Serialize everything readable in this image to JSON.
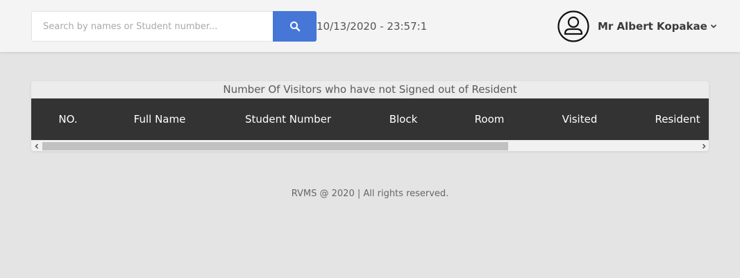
{
  "header": {
    "search": {
      "placeholder": "Search by names or Student number...",
      "value": "",
      "button_icon": "search-icon"
    },
    "datetime": "10/13/2020 - 23:57:1",
    "user": {
      "name": "Mr Albert Kopakae",
      "avatar_icon": "user-circle-icon",
      "dropdown_icon": "chevron-down-icon"
    }
  },
  "visitors_table": {
    "title": "Number Of Visitors who have not Signed out of Resident",
    "columns": [
      "NO.",
      "Full Name",
      "Student Number",
      "Block",
      "Room",
      "Visited",
      "Resident"
    ],
    "rows": []
  },
  "footer": {
    "text": "RVMS @ 2020 | All rights reserved."
  },
  "colors": {
    "accent": "#4677d7",
    "table_header_bg": "#333333",
    "page_bg": "#e4e4e4",
    "topbar_bg": "#f4f4f4"
  }
}
